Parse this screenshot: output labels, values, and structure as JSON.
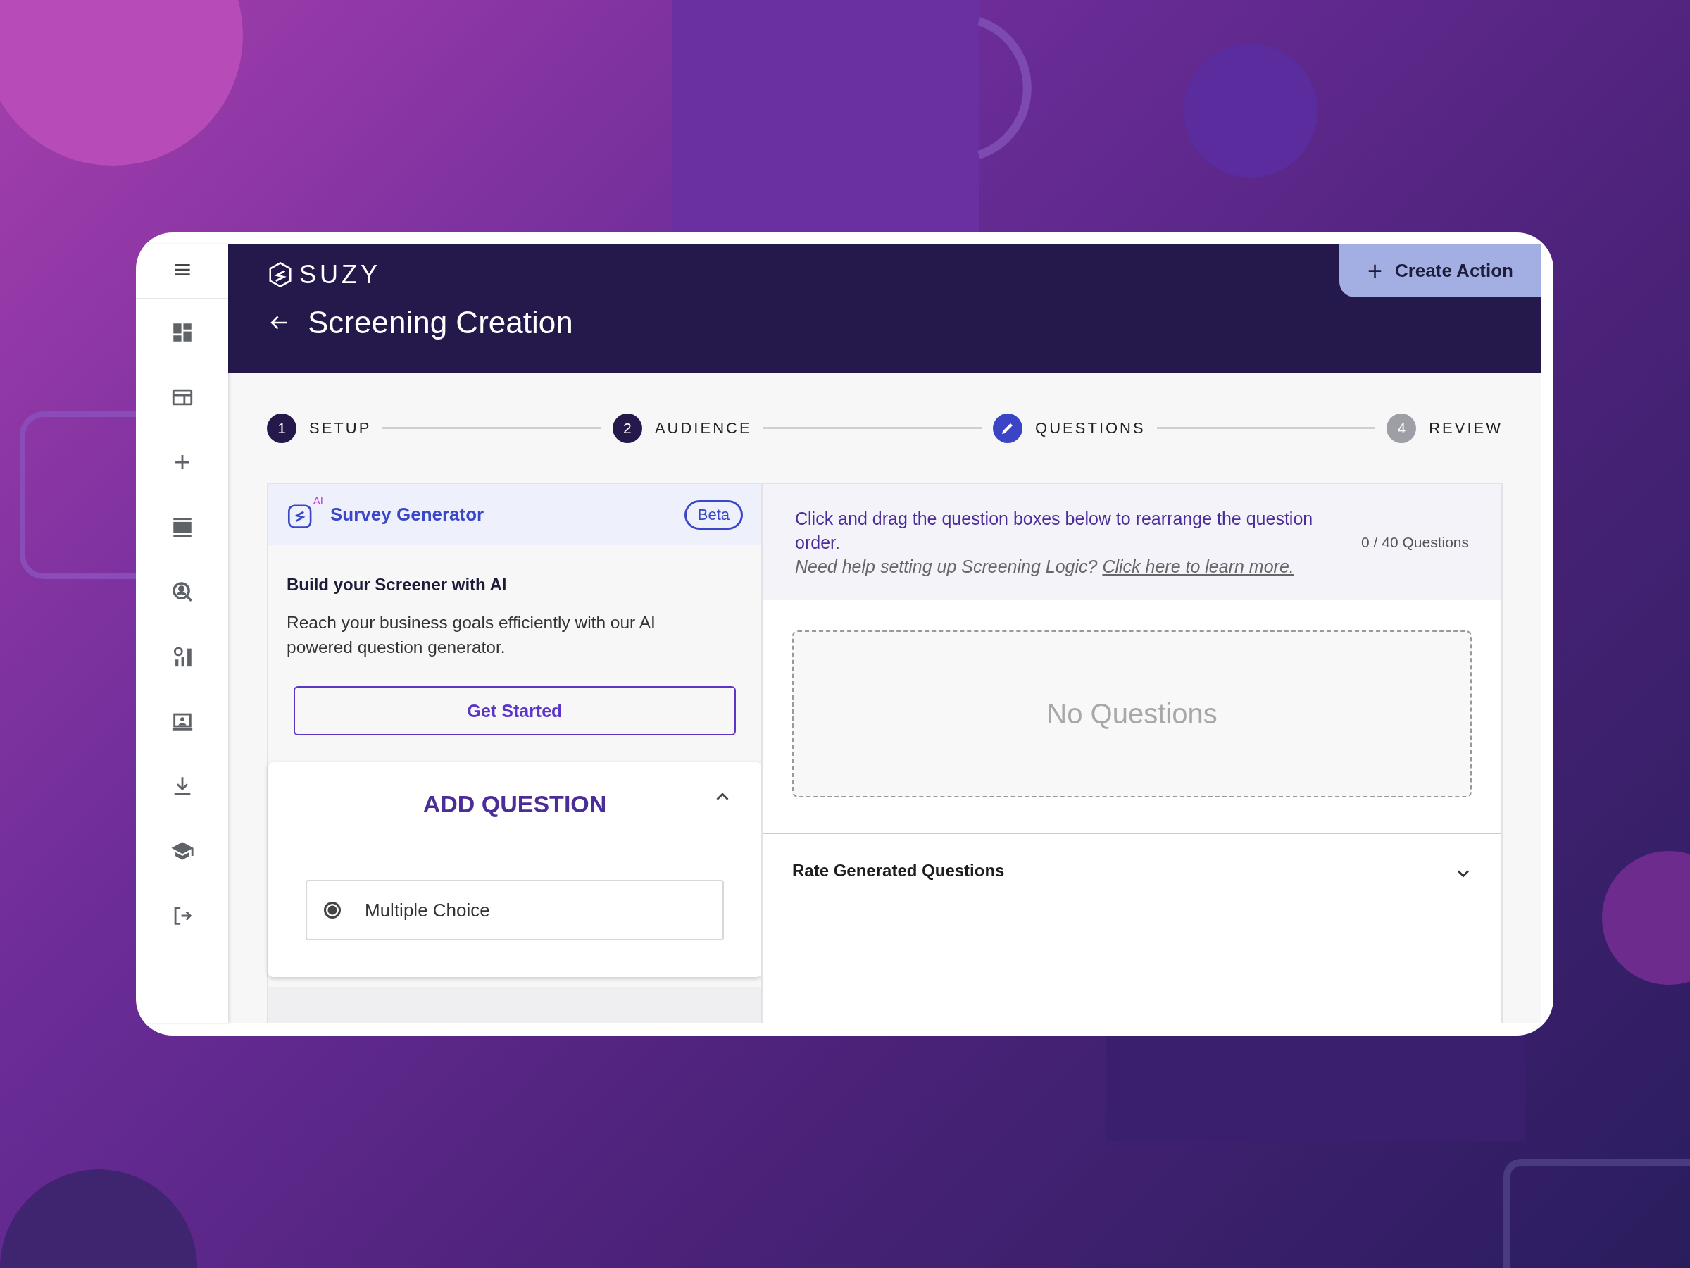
{
  "app": {
    "logo_text": "SUZY",
    "title": "Screening Creation",
    "create_action": {
      "icon": "+",
      "label": "Create Action"
    }
  },
  "steps": [
    {
      "number": "1",
      "label": "SETUP",
      "kind": "done"
    },
    {
      "number": "2",
      "label": "AUDIENCE",
      "kind": "done"
    },
    {
      "label": "QUESTIONS",
      "kind": "current"
    },
    {
      "number": "4",
      "label": "REVIEW",
      "kind": "upcoming"
    }
  ],
  "survey_generator": {
    "icon_label": "AI",
    "title": "Survey Generator",
    "badge": "Beta",
    "heading": "Build your Screener with AI",
    "description": "Reach your business goals efficiently with our AI powered question generator.",
    "button": "Get Started"
  },
  "add_question": {
    "title": "ADD QUESTION",
    "expanded": true,
    "options": [
      {
        "label": "Multiple Choice",
        "selected": true
      }
    ]
  },
  "questions_panel": {
    "instruction": "Click and drag the question boxes below to rearrange the question order.",
    "help_text": "Need help setting up Screening Logic?",
    "help_link": "Click here to learn more.",
    "count": "0 / 40 Questions",
    "empty_text": "No Questions"
  },
  "rate_section": {
    "title": "Rate Generated Questions",
    "expanded": false
  }
}
